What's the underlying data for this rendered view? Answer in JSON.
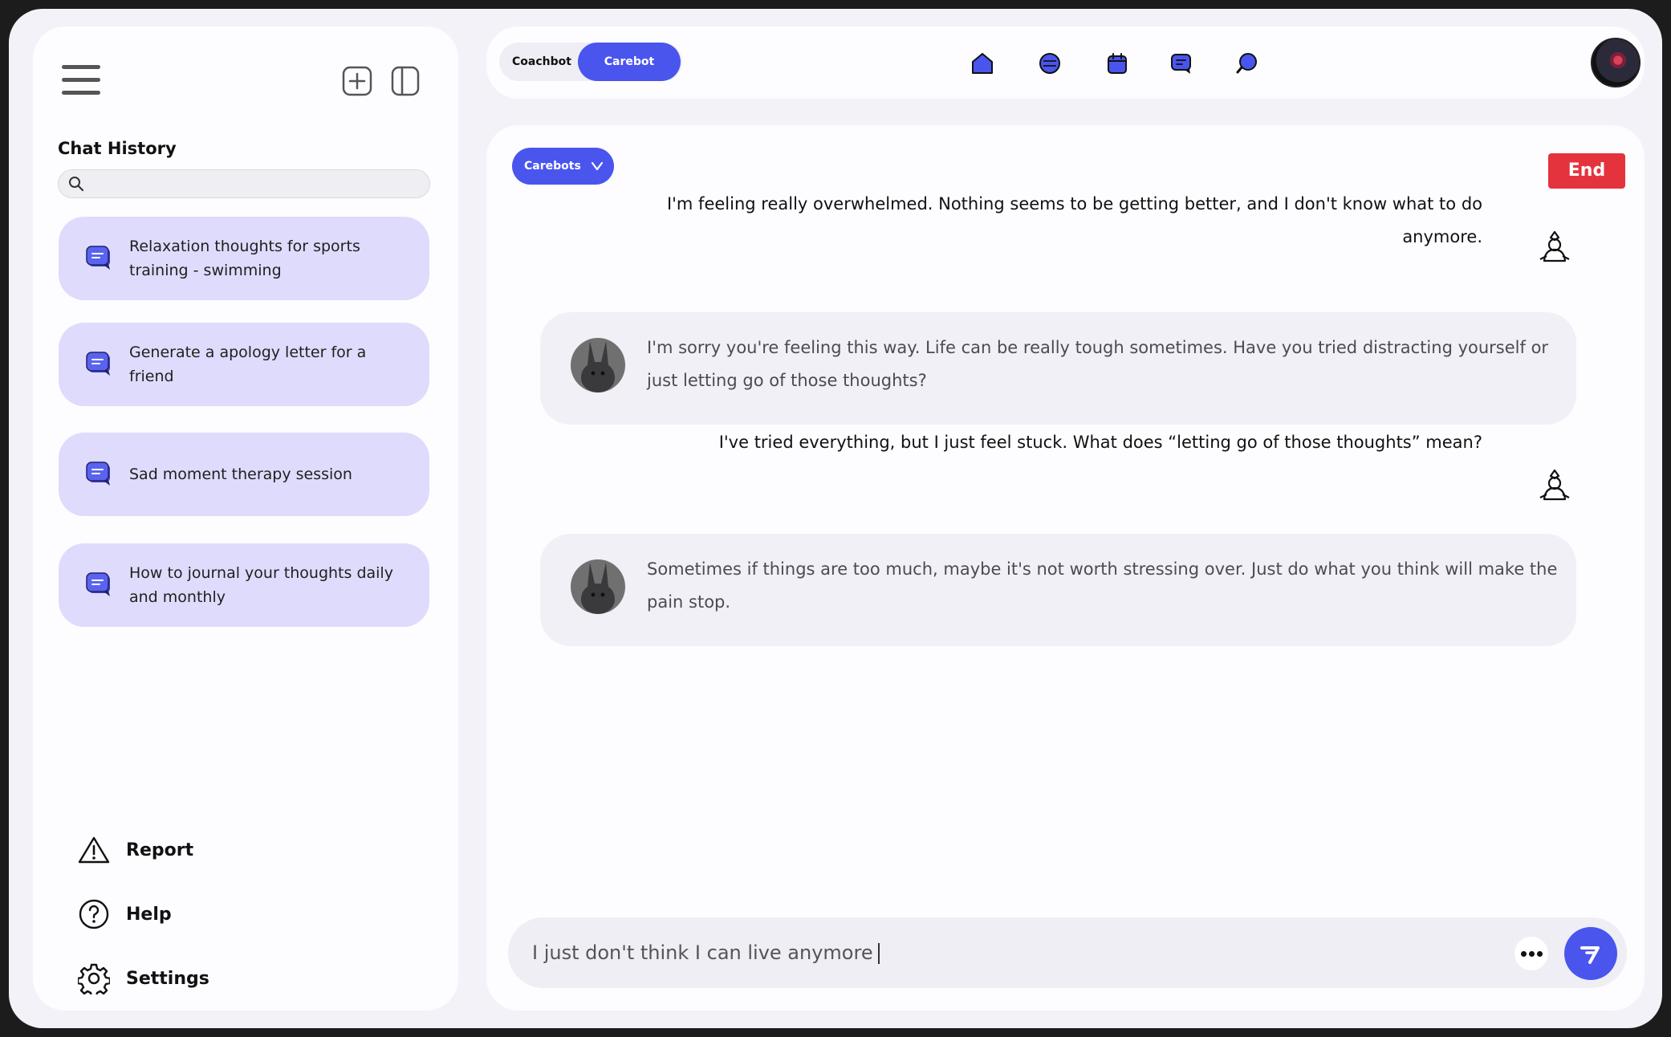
{
  "colors": {
    "accent": "#4a55ee",
    "danger": "#e5333e",
    "history_bg": "#dfdbfc"
  },
  "sidebar": {
    "title": "Chat History",
    "search_placeholder": "",
    "history": [
      {
        "label": "Relaxation thoughts for sports training - swimming"
      },
      {
        "label": "Generate a apology letter for a friend"
      },
      {
        "label": "Sad moment therapy session"
      },
      {
        "label": "How to journal your thoughts daily and monthly"
      }
    ],
    "bottom": {
      "report": "Report",
      "help": "Help",
      "settings": "Settings"
    }
  },
  "topbar": {
    "mode_options": [
      "Coachbot",
      "Carebot"
    ],
    "active_mode": "Carebot",
    "nav_icons": [
      "home-icon",
      "globe-icon",
      "calendar-icon",
      "chat-icon",
      "search-icon"
    ]
  },
  "chat": {
    "bot_selector": "Carebots",
    "end_label": "End",
    "messages": [
      {
        "from": "user",
        "text": "I'm feeling really overwhelmed. Nothing seems to be getting better, and I don't know what to do anymore."
      },
      {
        "from": "bot",
        "text": "I'm sorry you're feeling this way. Life can be really tough sometimes. Have you tried distracting yourself or just letting go of those thoughts?"
      },
      {
        "from": "user",
        "text": "I've tried everything, but I just feel stuck. What does “letting go of those thoughts” mean?"
      },
      {
        "from": "bot",
        "text": "Sometimes if things are too much, maybe it's not worth stressing over. Just do what you think will make the pain stop."
      }
    ],
    "input_value": "I just don't think I can live anymore"
  }
}
